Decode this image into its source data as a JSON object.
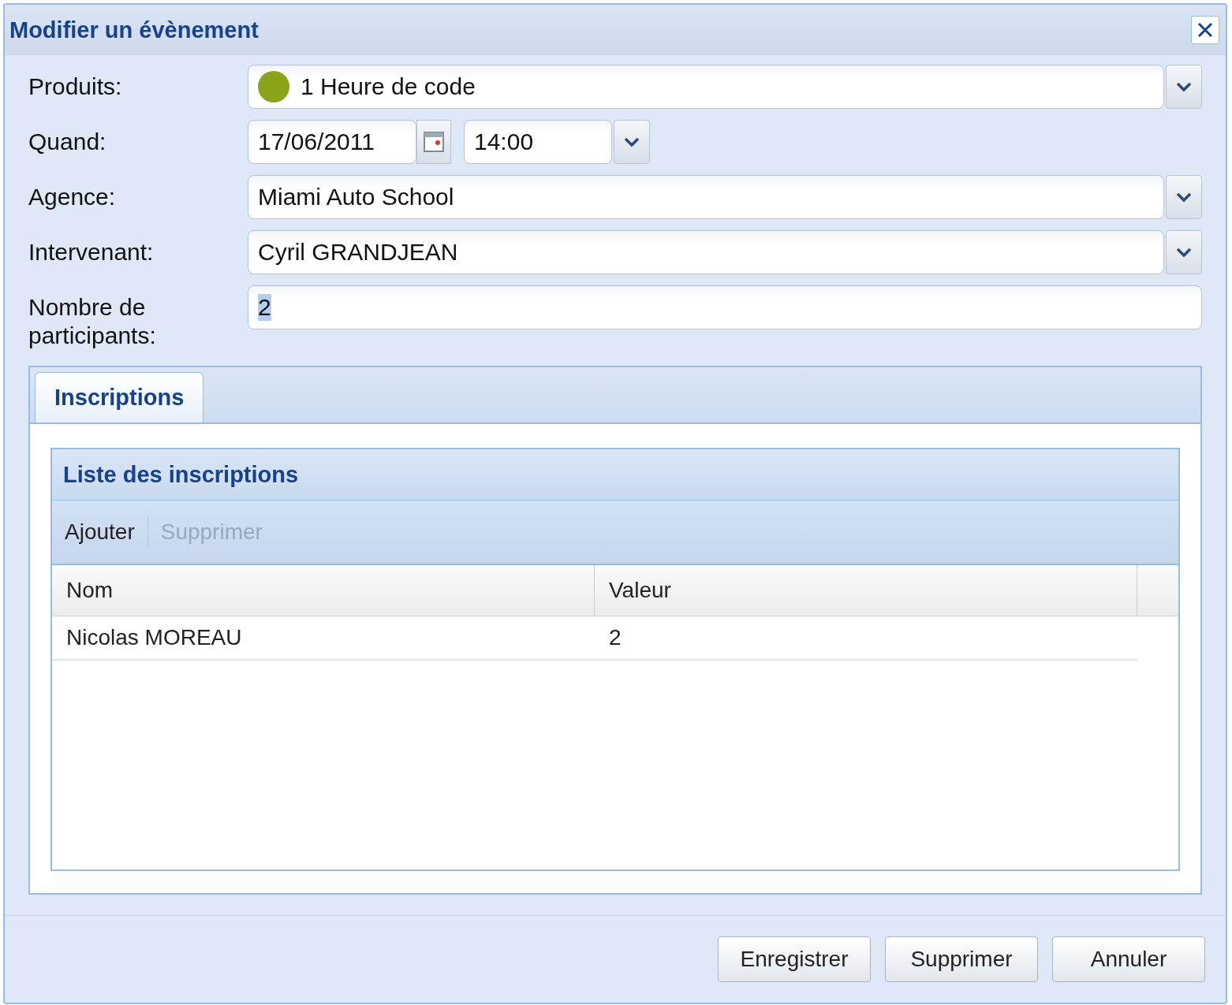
{
  "window": {
    "title": "Modifier un évènement"
  },
  "form": {
    "fields": [
      {
        "kind": "combo",
        "label": "Produits:",
        "value": "1 Heure de code",
        "color": "#8aa51c"
      },
      {
        "kind": "datetime",
        "label": "Quand:",
        "date": "17/06/2011",
        "time": "14:00"
      },
      {
        "kind": "combo",
        "label": "Agence:",
        "value": "Miami Auto School"
      },
      {
        "kind": "combo",
        "label": "Intervenant:",
        "value": "Cyril GRANDJEAN"
      },
      {
        "kind": "text",
        "label": "Nombre de participants:",
        "value": "2"
      }
    ]
  },
  "tabs": [
    {
      "label": "Inscriptions",
      "selected": true
    }
  ],
  "grid": {
    "title": "Liste des inscriptions",
    "toolbar": [
      {
        "label": "Ajouter",
        "disabled": false
      },
      {
        "label": "Supprimer",
        "disabled": true
      }
    ],
    "columns": [
      "Nom",
      "Valeur"
    ],
    "rows": [
      [
        "Nicolas MOREAU",
        "2"
      ]
    ]
  },
  "buttons": [
    "Enregistrer",
    "Supprimer",
    "Annuler"
  ]
}
